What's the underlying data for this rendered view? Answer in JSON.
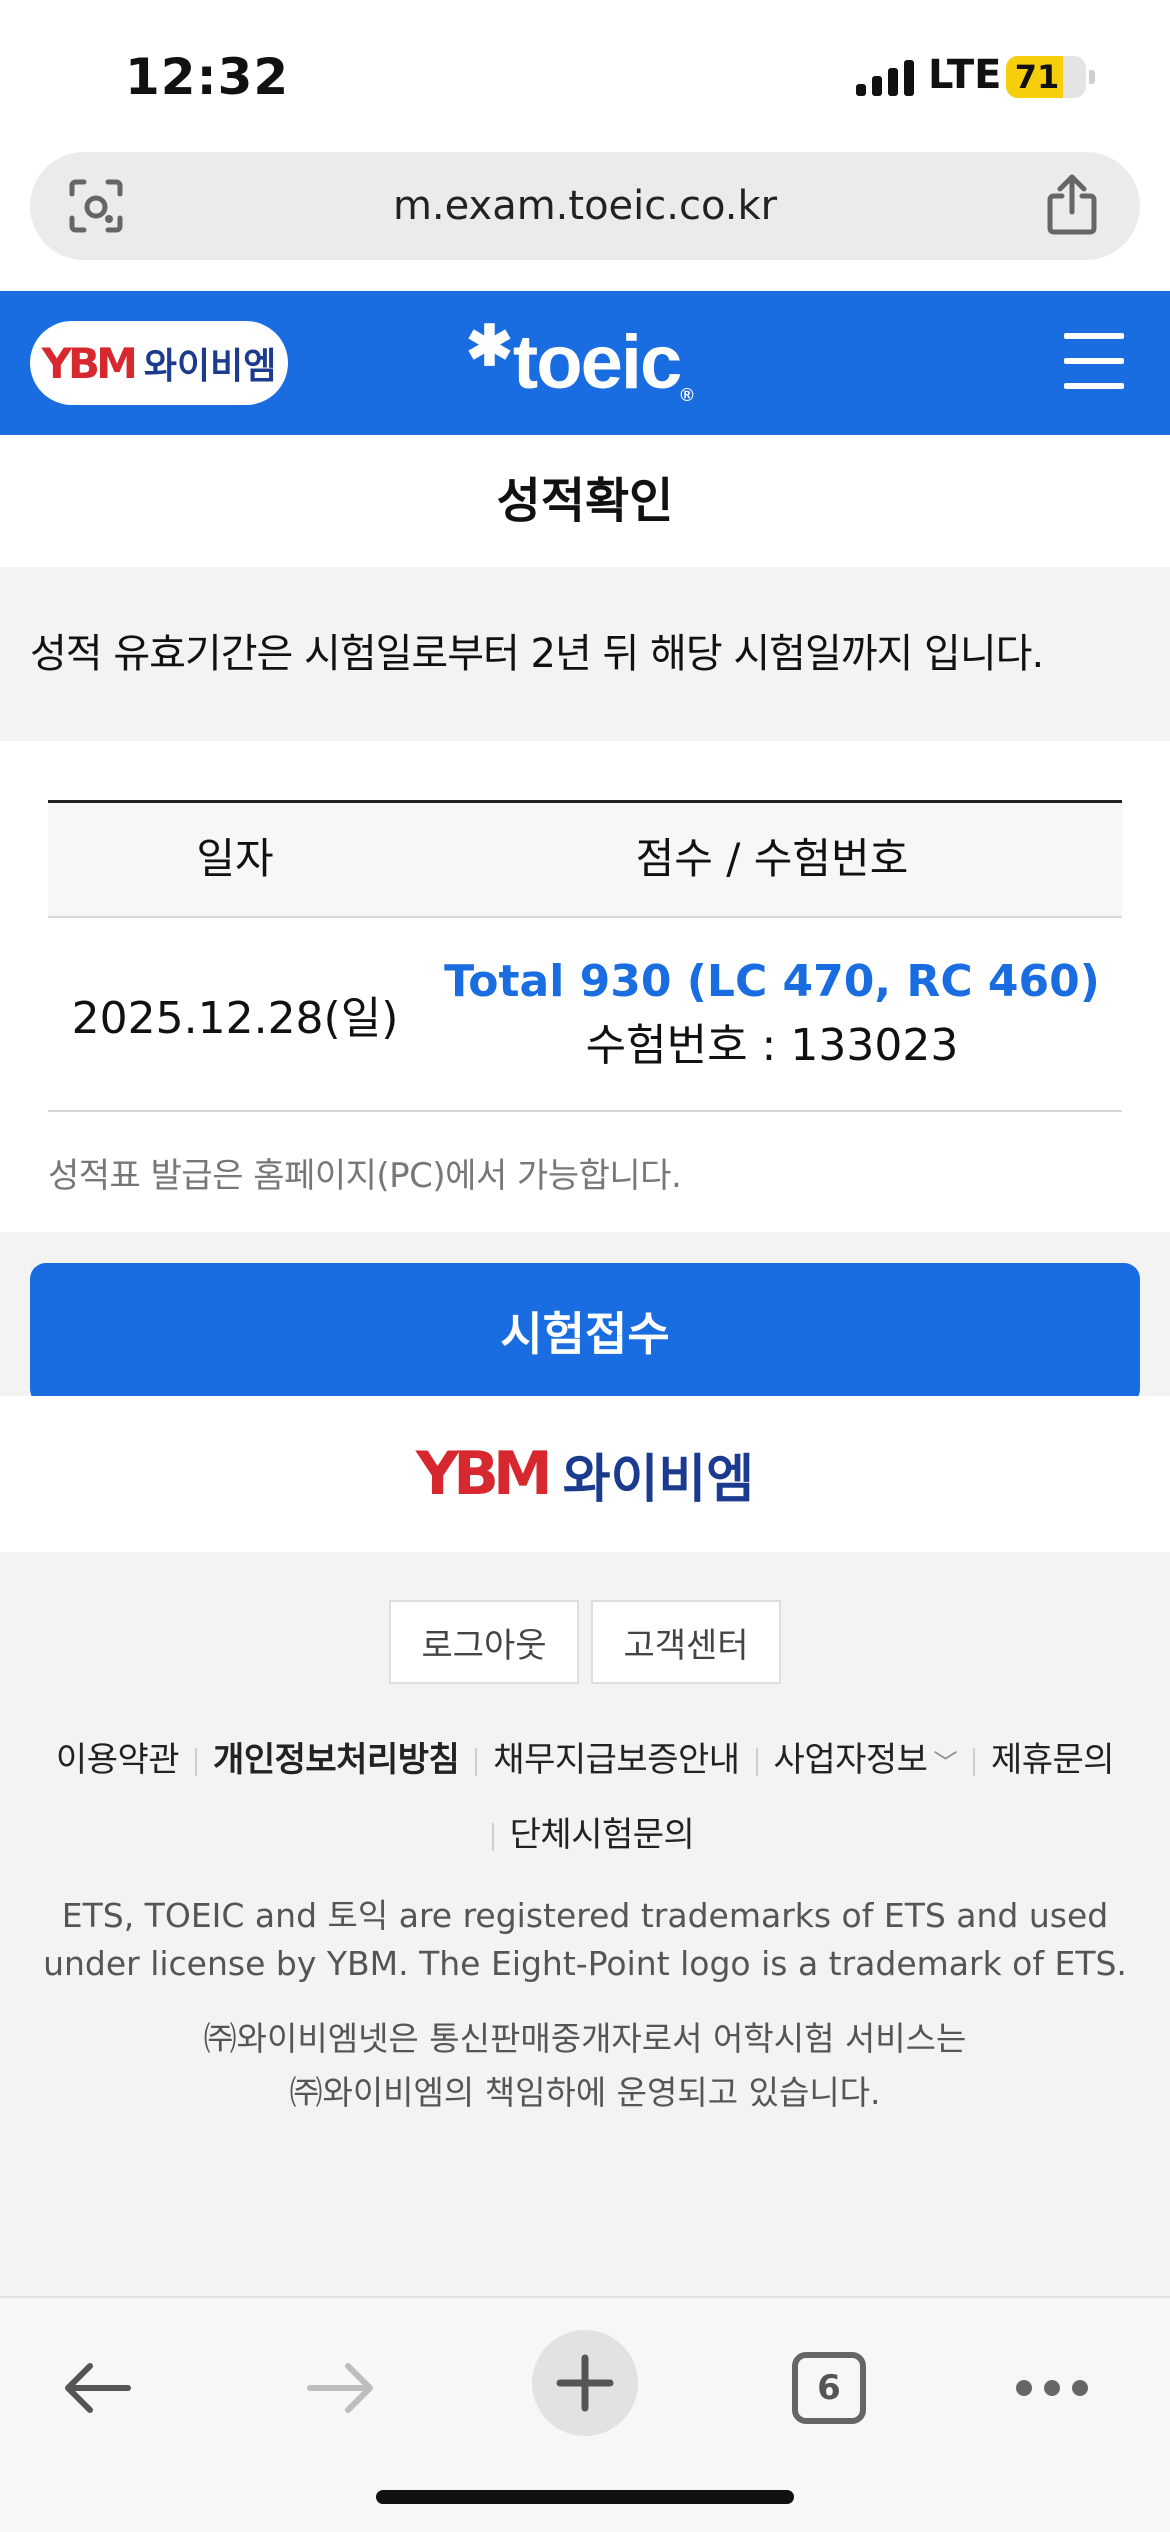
{
  "status_bar": {
    "time": "12:32",
    "network": "LTE",
    "battery": "71",
    "battery_level": 0.71
  },
  "browser": {
    "url": "m.exam.toeic.co.kr",
    "tab_count": "6"
  },
  "header": {
    "ybm_mark": "YBM",
    "ybm_name": "와이비엠",
    "toeic_logo": "toeic"
  },
  "page": {
    "title": "성적확인",
    "notice": "성적 유효기간은 시험일로부터 2년 뒤 해당 시험일까지 입니다.",
    "table": {
      "headers": {
        "date": "일자",
        "score": "점수 / 수험번호"
      },
      "rows": [
        {
          "date": "2025.12.28(일)",
          "total": "Total 930 (LC 470, RC 460)",
          "exam_id": "수험번호 : 133023"
        }
      ]
    },
    "report_note": "성적표 발급은 홈페이지(PC)에서 가능합니다.",
    "exam_button": "시험접수"
  },
  "footer": {
    "logout": "로그아웃",
    "support": "고객센터",
    "links": [
      "이용약관",
      "개인정보처리방침",
      "채무지급보증안내",
      "사업자정보",
      "제휴문의",
      "단체시험문의"
    ],
    "trademark": "ETS, TOEIC and 토익 are registered trademarks of ETS and used under license by YBM. The Eight-Point logo is a trademark of ETS.",
    "company_line1": "㈜와이비엠넷은 통신판매중개자로서 어학시험 서비스는",
    "company_line2": "㈜와이비엠의 책임하에 운영되고 있습니다."
  },
  "colors": {
    "brand_blue": "#1a6de0",
    "ybm_red": "#d8282f",
    "ybm_navy": "#1a3b8e",
    "battery_yellow": "#f7ce0b"
  },
  "icons": [
    "camera-lens-icon",
    "share-icon",
    "menu-icon",
    "chevron-down-icon",
    "back-arrow-icon",
    "forward-arrow-icon",
    "plus-icon",
    "tabs-icon",
    "more-icon"
  ]
}
